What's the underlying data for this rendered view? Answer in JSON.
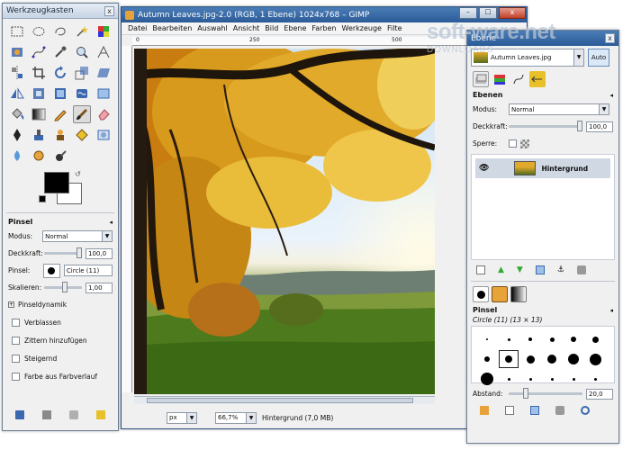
{
  "toolbox": {
    "title": "Werkzeugkasten",
    "close_label": "x",
    "brush_options": {
      "section_title": "Pinsel",
      "mode_label": "Modus:",
      "mode_value": "Normal",
      "opacity_label": "Deckkraft:",
      "opacity_value": "100,0",
      "brush_label": "Pinsel:",
      "brush_value": "Circle (11)",
      "scale_label": "Skalieren:",
      "scale_value": "1,00",
      "dynamics_label": "Pinseldynamik",
      "checkboxes": [
        "Verblassen",
        "Zittern hinzufügen",
        "Steigernd",
        "Farbe aus Farbverlauf"
      ]
    }
  },
  "gimp_window": {
    "title": "Autumn Leaves.jpg-2.0 (RGB, 1 Ebene) 1024x768 – GIMP",
    "menu": [
      "Datei",
      "Bearbeiten",
      "Auswahl",
      "Ansicht",
      "Bild",
      "Ebene",
      "Farben",
      "Werkzeuge",
      "Filte"
    ],
    "ruler_labels": [
      "0",
      "250",
      "500"
    ],
    "status": {
      "unit": "px",
      "zoom": "66,7%",
      "layer_info": "Hintergrund (7,0 MB)"
    }
  },
  "layers_dock": {
    "window_title_partial": "Ebene",
    "image_menu": "Autumn Leaves.jpg",
    "auto_label": "Auto",
    "section_title": "Ebenen",
    "mode_label": "Modus:",
    "mode_value": "Normal",
    "opacity_label": "Deckkraft:",
    "opacity_value": "100,0",
    "lock_label": "Sperre:",
    "layer_name": "Hintergrund"
  },
  "brushes_dock": {
    "section_title": "Pinsel",
    "brush_info": "Circle (11) (13 × 13)",
    "spacing_label": "Abstand:",
    "spacing_value": "20,0"
  },
  "watermark": {
    "brand": "soft-ware.net",
    "sub": "DOWNLOADS"
  },
  "colors": {
    "titlebar_blue": "#2c5c98",
    "fg_color": "#000000",
    "bg_color": "#ffffff"
  }
}
